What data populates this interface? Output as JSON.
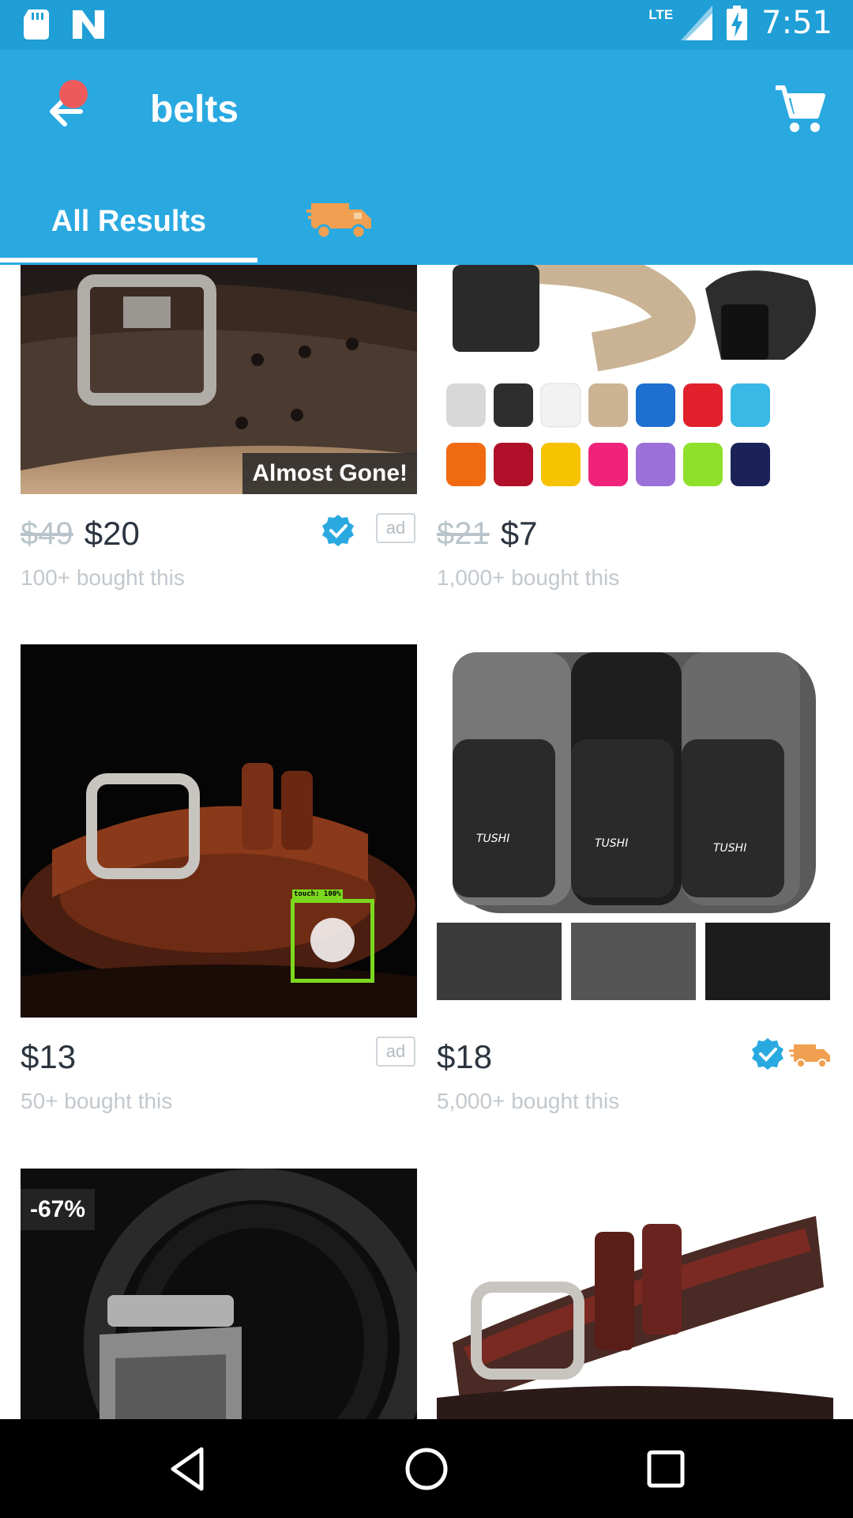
{
  "status_bar": {
    "time": "7:51",
    "network": "LTE"
  },
  "app_bar": {
    "title": "belts"
  },
  "tabs": {
    "all_results": "All Results"
  },
  "products": [
    {
      "old_price": "$49",
      "price": "$20",
      "bought": "100+ bought this",
      "badge": "Almost Gone!",
      "ad": "ad",
      "verified": true
    },
    {
      "old_price": "$21",
      "price": "$7",
      "bought": "1,000+ bought this"
    },
    {
      "price": "$13",
      "bought": "50+ bought this",
      "ad": "ad"
    },
    {
      "price": "$18",
      "bought": "5,000+ bought this",
      "verified": true,
      "fast_shipping": true,
      "brand_text": "TUSHI"
    },
    {
      "discount": "-67%"
    },
    {}
  ],
  "touch_overlay": {
    "label": "touch: 100%"
  },
  "colors": {
    "primary": "#2aa9e1",
    "status_bar": "#1f9fd6",
    "verified_blue": "#2aa9e1",
    "truck_orange": "#f0a050",
    "notif_red": "#ee5a5a"
  }
}
